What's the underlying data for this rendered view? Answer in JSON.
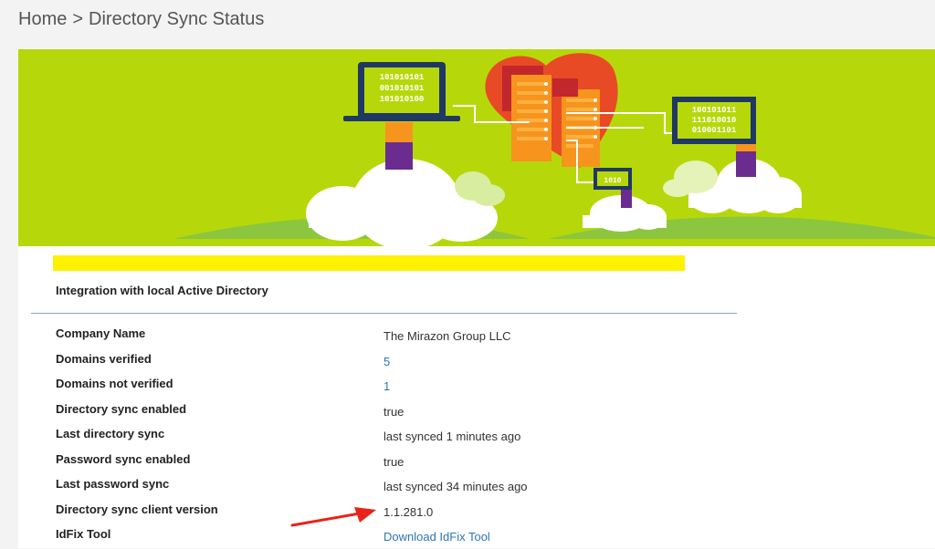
{
  "breadcrumb": {
    "home": "Home",
    "separator": ">",
    "current": "Directory Sync Status"
  },
  "banner": {
    "laptop_binary": [
      "101010101",
      "001010101",
      "101010100"
    ],
    "monitor_binary": [
      "100101011",
      "111010010",
      "010001101"
    ],
    "small_screen_binary": "1010",
    "colors": {
      "background": "#b6d80a",
      "heart": "#e84a26",
      "building": "#f7941d",
      "screen": "#1f3864",
      "screen_text": "#c9e36b",
      "person": "#6b2c8f",
      "cloud": "#ffffff"
    }
  },
  "section": {
    "title": "Integration with local Active Directory"
  },
  "rows": [
    {
      "label": "Company Name",
      "value": "The Mirazon Group LLC",
      "link": false
    },
    {
      "label": "Domains verified",
      "value": "5",
      "link": true
    },
    {
      "label": "Domains not verified",
      "value": "1",
      "link": true
    },
    {
      "label": "Directory sync enabled",
      "value": "true",
      "link": false
    },
    {
      "label": "Last directory sync",
      "value": "last synced 1 minutes ago",
      "link": false
    },
    {
      "label": "Password sync enabled",
      "value": "true",
      "link": false
    },
    {
      "label": "Last password sync",
      "value": "last synced 34 minutes ago",
      "link": false
    },
    {
      "label": "Directory sync client version",
      "value": "1.1.281.0",
      "link": false
    },
    {
      "label": "IdFix Tool",
      "value": "Download IdFix Tool",
      "link": true
    }
  ],
  "annotation": {
    "arrow_color": "#e8231a"
  }
}
